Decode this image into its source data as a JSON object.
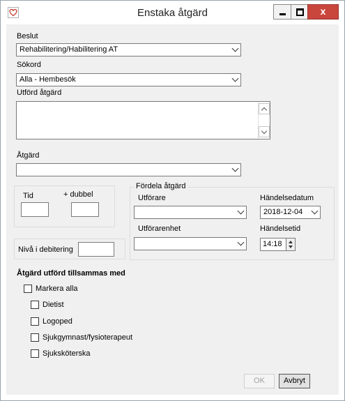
{
  "window": {
    "title": "Enstaka åtgärd",
    "close_label": "x"
  },
  "form": {
    "beslut": {
      "label": "Beslut",
      "value": "Rehabilitering/Habilitering AT"
    },
    "sokord": {
      "label": "Sökord",
      "value": "Alla - Hembesök"
    },
    "utford_atgard": {
      "label": "Utförd åtgärd",
      "value": ""
    },
    "atgard": {
      "label": "Åtgärd",
      "value": ""
    },
    "tid": {
      "label": "Tid",
      "value": ""
    },
    "dubbel": {
      "label": "+ dubbel",
      "value": ""
    },
    "niva_debitering": {
      "label": "Nivå i debitering",
      "value": ""
    }
  },
  "fordela": {
    "group_label": "Fördela åtgärd",
    "utforare": {
      "label": "Utförare",
      "value": ""
    },
    "utforarenhet": {
      "label": "Utförarenhet",
      "value": ""
    },
    "handelsedatum": {
      "label": "Händelsedatum",
      "value": "2018-12-04"
    },
    "handelsetid": {
      "label": "Händelsetid",
      "value": "14:18"
    }
  },
  "together": {
    "heading": "Åtgärd utförd tillsammas med",
    "mark_all": "Markera alla",
    "options": [
      "Dietist",
      "Logoped",
      "Sjukgymnast/fysioterapeut",
      "Sjuksköterska"
    ]
  },
  "buttons": {
    "ok": "OK",
    "cancel": "Avbryt"
  },
  "colors": {
    "close_button": "#c9463d",
    "panel_bg": "#f0f0f0",
    "app_icon_heart": "#c0392b"
  }
}
